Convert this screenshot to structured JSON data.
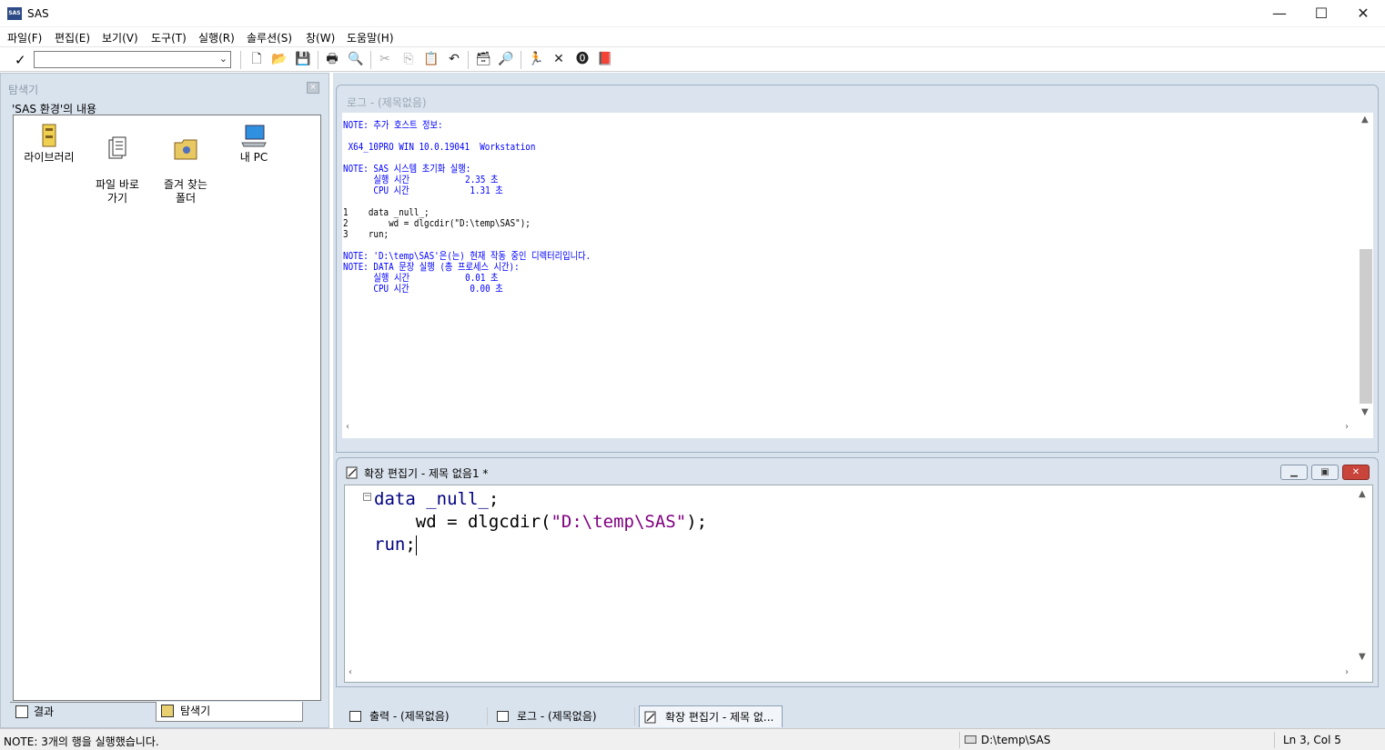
{
  "window": {
    "title": "SAS",
    "icon": "sas-app-icon",
    "minimize": "—",
    "maximize": "☐",
    "close": "✕"
  },
  "menu": [
    "파일(F)",
    "편집(E)",
    "보기(V)",
    "도구(T)",
    "실행(R)",
    "솔루션(S)",
    "창(W)",
    "도움말(H)"
  ],
  "toolbar": {
    "command_value": "",
    "check_glyph": "✓",
    "dropdown_glyph": "⌄",
    "buttons": [
      {
        "name": "new-icon",
        "glyph": "🗋"
      },
      {
        "name": "open-icon",
        "glyph": "📂"
      },
      {
        "name": "save-icon",
        "glyph": "💾"
      },
      {
        "name": "print-icon",
        "glyph": "🖶"
      },
      {
        "name": "print-preview-icon",
        "glyph": "🔍"
      },
      {
        "name": "cut-icon",
        "glyph": "✂"
      },
      {
        "name": "copy-icon",
        "glyph": "⎘"
      },
      {
        "name": "paste-icon",
        "glyph": "📋"
      },
      {
        "name": "undo-icon",
        "glyph": "↶"
      },
      {
        "name": "new-library-icon",
        "glyph": "🗃"
      },
      {
        "name": "explorer-icon",
        "glyph": "🔎"
      },
      {
        "name": "submit-icon",
        "glyph": "🏃"
      },
      {
        "name": "clear-icon",
        "glyph": "✕"
      },
      {
        "name": "break-icon",
        "glyph": "⓿"
      },
      {
        "name": "help-icon",
        "glyph": "📕"
      }
    ]
  },
  "explorer": {
    "title": "탐색기",
    "close_glyph": "×",
    "content_label": "'SAS 환경'의 내용",
    "items": [
      {
        "label": "라이브러리",
        "icon": "library-cabinet-icon"
      },
      {
        "label": "파일 바로\n가기",
        "icon": "file-shortcut-icon"
      },
      {
        "label": "즐겨 찾는\n폴더",
        "icon": "favorite-folder-icon"
      },
      {
        "label": "내 PC",
        "icon": "my-pc-icon"
      }
    ],
    "tabs": [
      {
        "label": "결과",
        "icon": "results-icon"
      },
      {
        "label": "탐색기",
        "icon": "explorer-tab-icon"
      }
    ]
  },
  "log": {
    "title": "로그 - (제목없음)",
    "lines": [
      {
        "text": "NOTE: 추가 호스트 정보:",
        "color": "blue"
      },
      {
        "text": "",
        "color": "blue"
      },
      {
        "text": " X64_10PRO WIN 10.0.19041  Workstation",
        "color": "blue"
      },
      {
        "text": "",
        "color": "blue"
      },
      {
        "text": "NOTE: SAS 시스템 초기화 실행:",
        "color": "blue"
      },
      {
        "text": "      실행 시간           2.35 초",
        "color": "blue"
      },
      {
        "text": "      CPU 시간            1.31 초",
        "color": "blue"
      },
      {
        "text": "",
        "color": "blue"
      },
      {
        "text": "1    data _null_;",
        "color": "black"
      },
      {
        "text": "2        wd = dlgcdir(\"D:\\temp\\SAS\");",
        "color": "black"
      },
      {
        "text": "3    run;",
        "color": "black"
      },
      {
        "text": "",
        "color": "blue"
      },
      {
        "text": "NOTE: 'D:\\temp\\SAS'은(는) 현재 작동 중인 디렉터리입니다.",
        "color": "blue"
      },
      {
        "text": "NOTE: DATA 문장 실행 (총 프로세스 시간):",
        "color": "blue"
      },
      {
        "text": "      실행 시간           0.01 초",
        "color": "blue"
      },
      {
        "text": "      CPU 시간            0.00 초",
        "color": "blue"
      }
    ]
  },
  "editor": {
    "title": "확장 편집기 - 제목 없음1 *",
    "fold_glyph": "−",
    "code": {
      "line1_kw": "data",
      "line1_rest": " _null_",
      "line1_end": ";",
      "line2_pre": "    wd = dlgcdir(",
      "line2_str": "\"D:\\temp\\SAS\"",
      "line2_end": ");",
      "line3_kw": "run",
      "line3_end": ";"
    }
  },
  "taskbar": [
    {
      "label": "출력 - (제목없음)",
      "icon": "output-window-icon",
      "active": false
    },
    {
      "label": "로그 - (제목없음)",
      "icon": "log-window-icon",
      "active": false
    },
    {
      "label": "확장 편집기 - 제목 없...",
      "icon": "editor-window-icon",
      "active": true
    }
  ],
  "status": {
    "message": "NOTE:  3개의 행을 실행했습니다.",
    "path": "D:\\temp\\SAS",
    "position": "Ln 3, Col 5"
  },
  "colors": {
    "log_blue": "#0000ff",
    "mdi_bg": "#d9e3ee",
    "keyword": "#000080",
    "string": "#800080"
  }
}
